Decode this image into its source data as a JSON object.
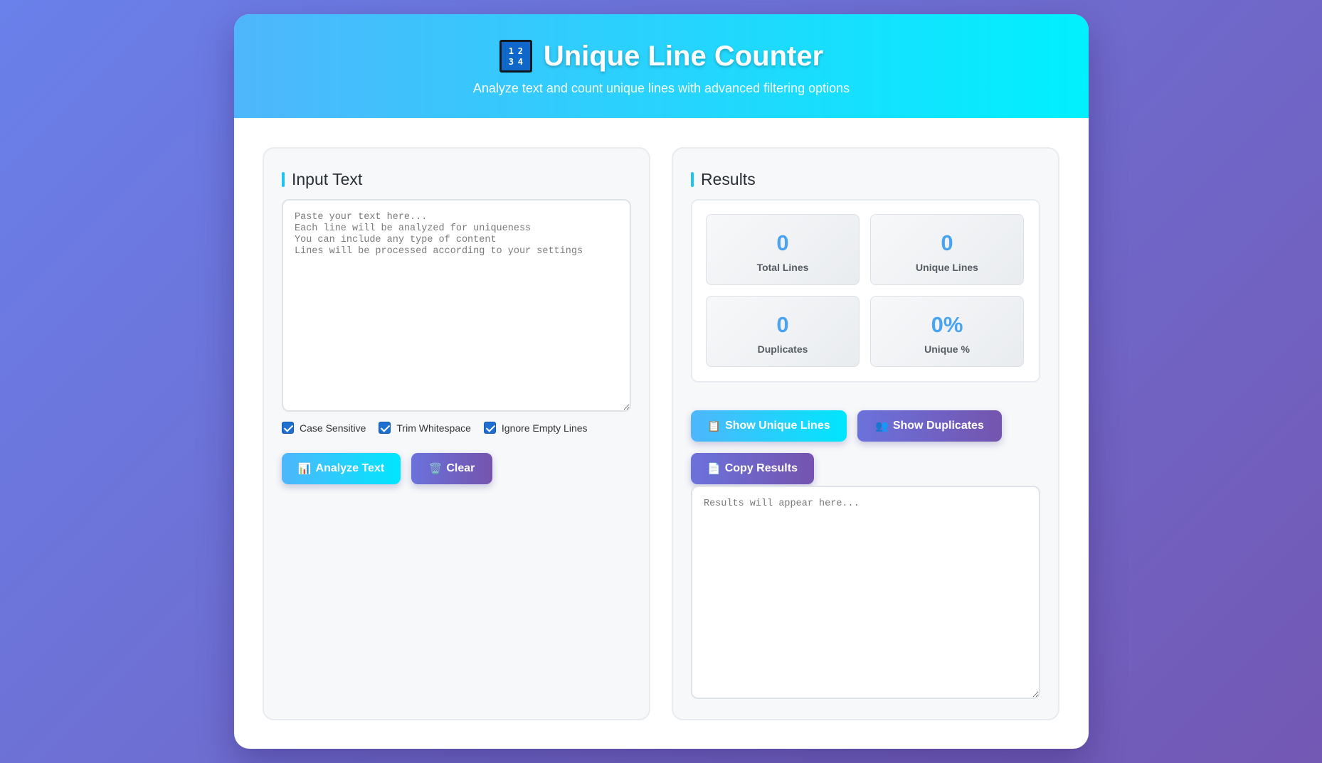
{
  "header": {
    "icon_digits": [
      "1",
      "2",
      "3",
      "4"
    ],
    "title": "Unique Line Counter",
    "subtitle": "Analyze text and count unique lines with advanced filtering options"
  },
  "input_panel": {
    "heading": "Input Text",
    "textarea_placeholder": "Paste your text here...\nEach line will be analyzed for uniqueness\nYou can include any type of content\nLines will be processed according to your settings",
    "options": [
      {
        "label": "Case Sensitive",
        "checked": true
      },
      {
        "label": "Trim Whitespace",
        "checked": true
      },
      {
        "label": "Ignore Empty Lines",
        "checked": true
      }
    ],
    "analyze_label": "Analyze Text",
    "analyze_icon": "📊",
    "clear_label": "Clear",
    "clear_icon": "🗑️"
  },
  "results_panel": {
    "heading": "Results",
    "stats": [
      {
        "value": "0",
        "label": "Total Lines"
      },
      {
        "value": "0",
        "label": "Unique Lines"
      },
      {
        "value": "0",
        "label": "Duplicates"
      },
      {
        "value": "0%",
        "label": "Unique %"
      }
    ],
    "show_unique_label": "Show Unique Lines",
    "show_unique_icon": "📋",
    "show_duplicates_label": "Show Duplicates",
    "show_duplicates_icon": "👥",
    "copy_label": "Copy Results",
    "copy_icon": "📄",
    "results_placeholder": "Results will appear here..."
  },
  "colors": {
    "accent_cyan": "#1fc4f0",
    "stat_value": "#49a3f0",
    "button_purple": "#7454ae"
  }
}
